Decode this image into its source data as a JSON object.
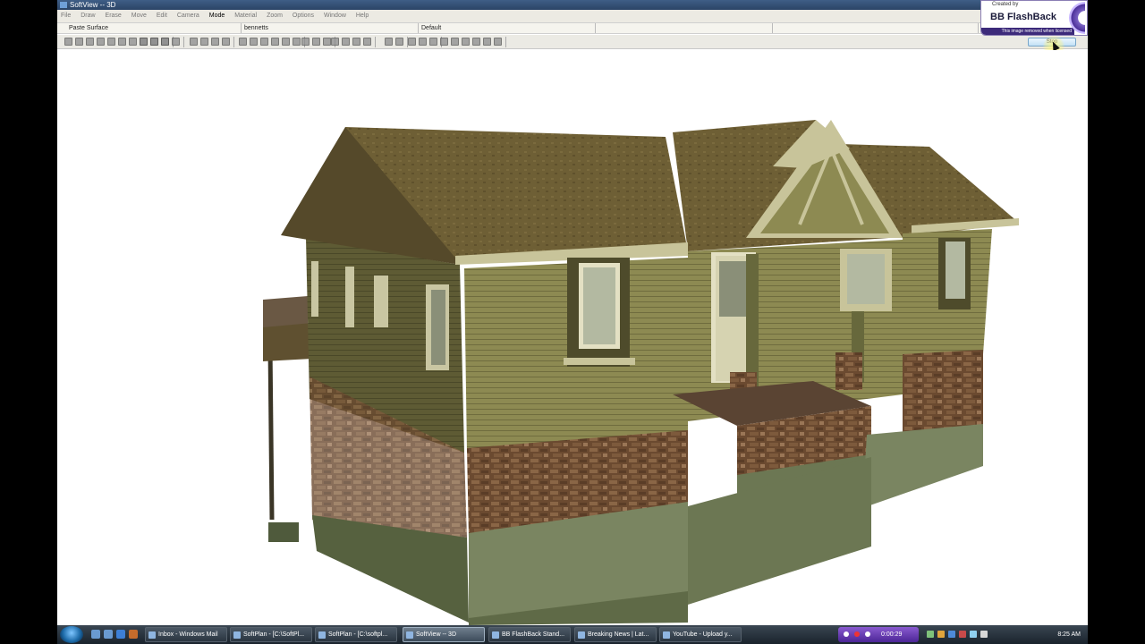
{
  "window": {
    "title": "SoftView -- 3D"
  },
  "menu": [
    {
      "label": "File",
      "active": false
    },
    {
      "label": "Draw",
      "active": false
    },
    {
      "label": "Erase",
      "active": false
    },
    {
      "label": "Move",
      "active": false
    },
    {
      "label": "Edit",
      "active": false
    },
    {
      "label": "Camera",
      "active": false
    },
    {
      "label": "Mode",
      "active": true
    },
    {
      "label": "Material",
      "active": false
    },
    {
      "label": "Zoom",
      "active": false
    },
    {
      "label": "Options",
      "active": false
    },
    {
      "label": "Window",
      "active": false
    },
    {
      "label": "Help",
      "active": false
    }
  ],
  "fields": {
    "command": "Paste Surface",
    "project": "bennetts",
    "view": "Default"
  },
  "flashback": {
    "created_by": "Created by",
    "brand": "BB FlashBack",
    "notice": "This image removed when licensed",
    "stop_label": "Stop"
  },
  "taskbar": {
    "tasks": [
      {
        "label": "Inbox - Windows Mail",
        "active": false
      },
      {
        "label": "SoftPlan - [C:\\SoftPl...",
        "active": false
      },
      {
        "label": "SoftPlan - [C:\\softpl...",
        "active": false
      },
      {
        "label": "SoftView -- 3D",
        "active": true
      },
      {
        "label": "BB FlashBack Stand...",
        "active": false
      },
      {
        "label": "Breaking News | Lat...",
        "active": false
      },
      {
        "label": "YouTube - Upload y...",
        "active": false
      }
    ],
    "recorder_time": "0:00:29",
    "clock": "8:25 AM"
  },
  "colors": {
    "siding": "#8d8a52",
    "roof": "#6e5f35",
    "trim": "#c8c49a",
    "stone": "#6b4a30",
    "foundation": "#7a8561",
    "porch_deck": "#5a4433"
  }
}
